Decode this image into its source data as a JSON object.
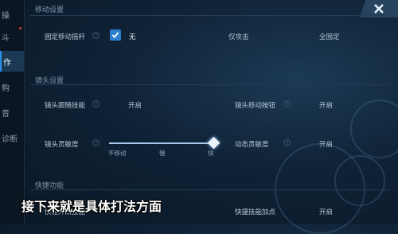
{
  "sidebar": {
    "items": [
      {
        "label": "操"
      },
      {
        "label": "斗"
      },
      {
        "label": "作"
      },
      {
        "label": "购"
      },
      {
        "label": "音"
      },
      {
        "label": "诊断"
      }
    ]
  },
  "sections": {
    "move": {
      "title": "移动设置",
      "fixed_joystick_label": "固定移动摇杆",
      "fixed_joystick_value": "无",
      "option_mid": "仅攻击",
      "option_right": "全固定"
    },
    "camera": {
      "title": "镜头设置",
      "follow_label": "镜头跟随技能",
      "follow_value": "开启",
      "move_btn_label": "镜头移动按钮",
      "move_btn_value": "开启",
      "sensitivity_label": "镜头灵敏度",
      "sensitivity_ticks": [
        "不移动",
        "慢",
        "快"
      ],
      "sensitivity_level": 1.0,
      "dynamic_label": "动态灵敏度",
      "dynamic_value": "开启"
    },
    "quick": {
      "title": "快捷功能",
      "left_label": "快速开启技能",
      "right_label": "快捷技能加点",
      "right_value": "开启"
    }
  },
  "subtitle": "接下来就是具体打法方面",
  "colors": {
    "accent": "#2f7fd0",
    "background": "#0f2236",
    "sidebar_active": "#1b3954"
  }
}
